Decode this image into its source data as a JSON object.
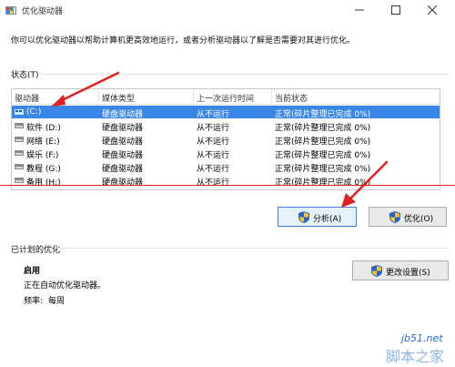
{
  "window": {
    "title": "优化驱动器"
  },
  "description": "你可以优化驱动器以帮助计算机更高效地运行，或者分析驱动器以了解是否需要对其进行优化。",
  "status": {
    "label": "状态(T)",
    "columns": [
      "驱动器",
      "媒体类型",
      "上一次运行时间",
      "当前状态"
    ],
    "rows": [
      {
        "drive": "(C:)",
        "media": "硬盘驱动器",
        "last_run": "从不运行",
        "state": "正常(碎片整理已完成 0%)",
        "selected": true
      },
      {
        "drive": "软件 (D:)",
        "media": "硬盘驱动器",
        "last_run": "从不运行",
        "state": "正常(碎片整理已完成 0%)",
        "selected": false
      },
      {
        "drive": "网络 (E:)",
        "media": "硬盘驱动器",
        "last_run": "从不运行",
        "state": "正常(碎片整理已完成 0%)",
        "selected": false
      },
      {
        "drive": "娱乐 (F:)",
        "media": "硬盘驱动器",
        "last_run": "从不运行",
        "state": "正常(碎片整理已完成 0%)",
        "selected": false
      },
      {
        "drive": "教程 (G:)",
        "media": "硬盘驱动器",
        "last_run": "从不运行",
        "state": "正常(碎片整理已完成 0%)",
        "selected": false
      },
      {
        "drive": "备用 (H:)",
        "media": "硬盘驱动器",
        "last_run": "从不运行",
        "state": "正常(碎片整理已完成 0%)",
        "selected": false
      }
    ]
  },
  "buttons": {
    "analyze": "分析(A)",
    "optimize": "优化(O)",
    "change_settings": "更改设置(S)"
  },
  "scheduled": {
    "label": "已计划的优化",
    "enabled": "启用",
    "auto_text": "正在自动优化驱动器。",
    "frequency_label": "频率:",
    "frequency_value": "每周"
  },
  "watermark": {
    "site": "jb51.net",
    "name": "脚本之家"
  },
  "colors": {
    "selection": "#3a86e6",
    "annotation_red": "#e02020"
  }
}
